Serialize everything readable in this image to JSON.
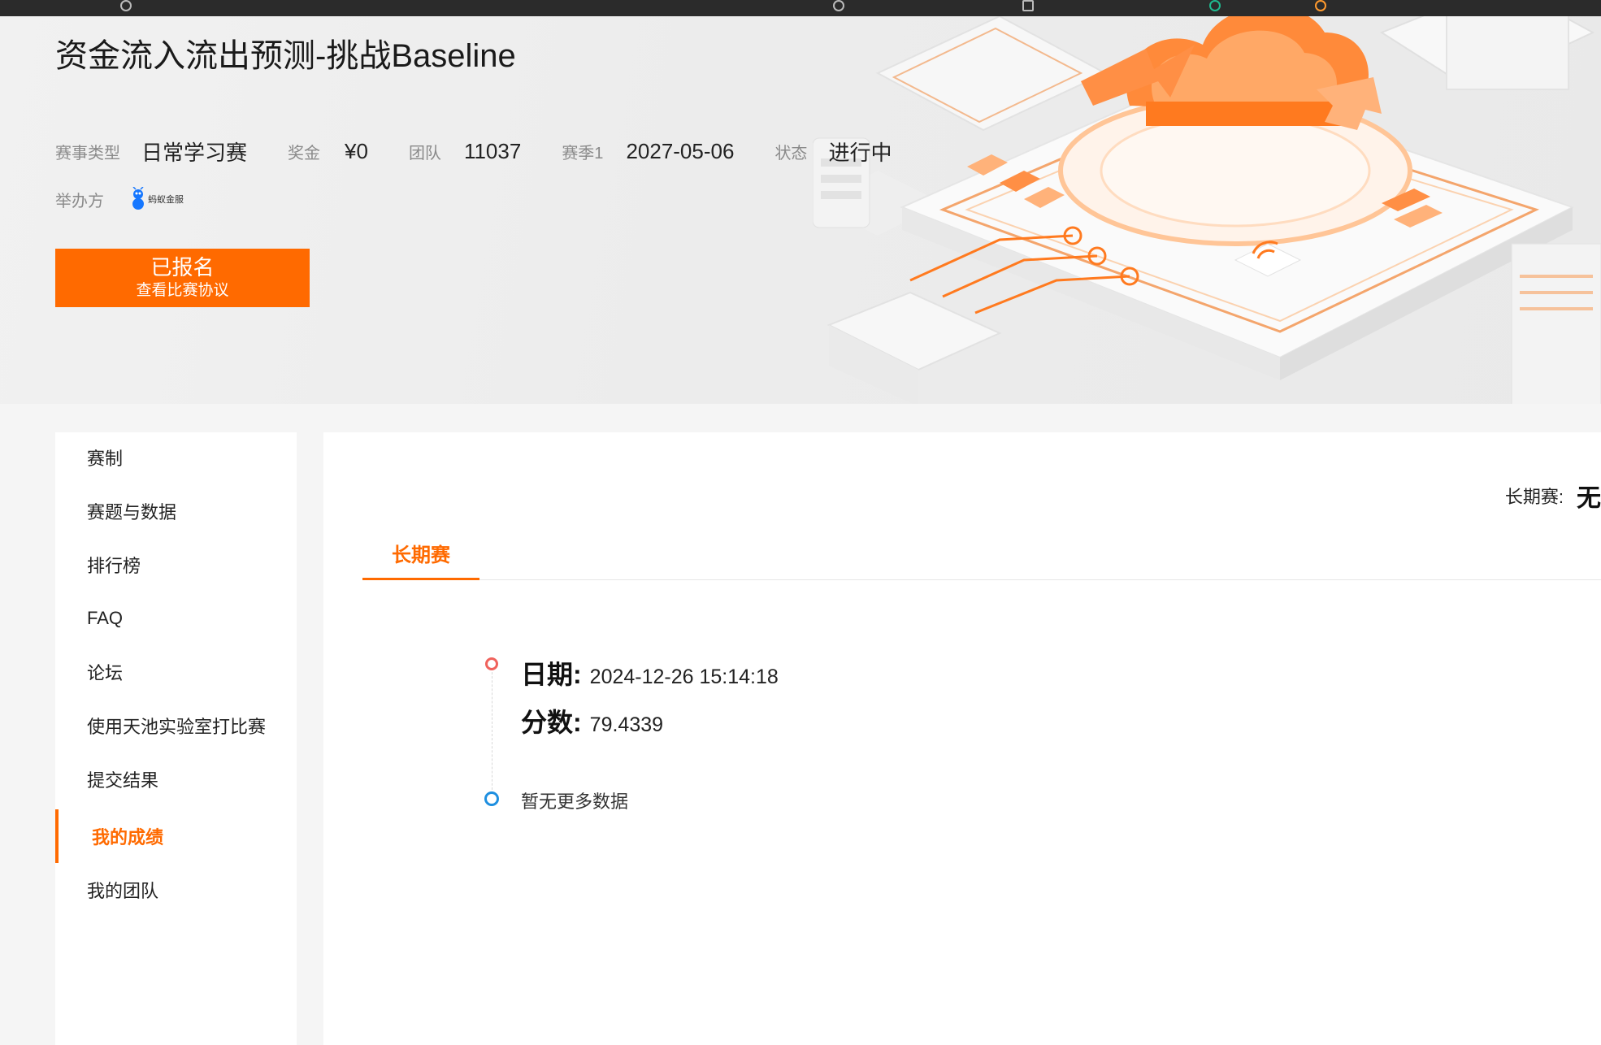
{
  "browser_tabs": [
    "",
    "",
    "",
    "",
    "",
    "",
    "",
    "",
    "",
    "",
    ""
  ],
  "competition": {
    "title": "资金流入流出预测-挑战Baseline",
    "meta": [
      {
        "label": "赛事类型",
        "value": "日常学习赛"
      },
      {
        "label": "奖金",
        "value": "¥0"
      },
      {
        "label": "团队",
        "value": "11037"
      },
      {
        "label": "赛季1",
        "value": "2027-05-06"
      },
      {
        "label": "状态",
        "value": "进行中"
      }
    ],
    "organizer_label": "举办方",
    "organizer_logo_text": "蚂蚁金服",
    "signup_main": "已报名",
    "signup_sub": "查看比赛协议"
  },
  "sidebar": {
    "items": [
      {
        "label": "赛制"
      },
      {
        "label": "赛题与数据"
      },
      {
        "label": "排行榜"
      },
      {
        "label": "FAQ"
      },
      {
        "label": "论坛"
      },
      {
        "label": "使用天池实验室打比赛"
      },
      {
        "label": "提交结果"
      },
      {
        "label": "我的成绩"
      },
      {
        "label": "我的团队"
      }
    ],
    "active_index": 7
  },
  "main": {
    "season_label": "长期赛:",
    "season_value": "无",
    "tab_label": "长期赛",
    "record": {
      "date_key": "日期:",
      "date_value": "2024-12-26 15:14:18",
      "score_key": "分数:",
      "score_value": "79.4339"
    },
    "no_more_text": "暂无更多数据"
  },
  "colors": {
    "accent": "#ff6a00",
    "timeline_red": "#f0625c",
    "timeline_blue": "#1e8fe0"
  }
}
